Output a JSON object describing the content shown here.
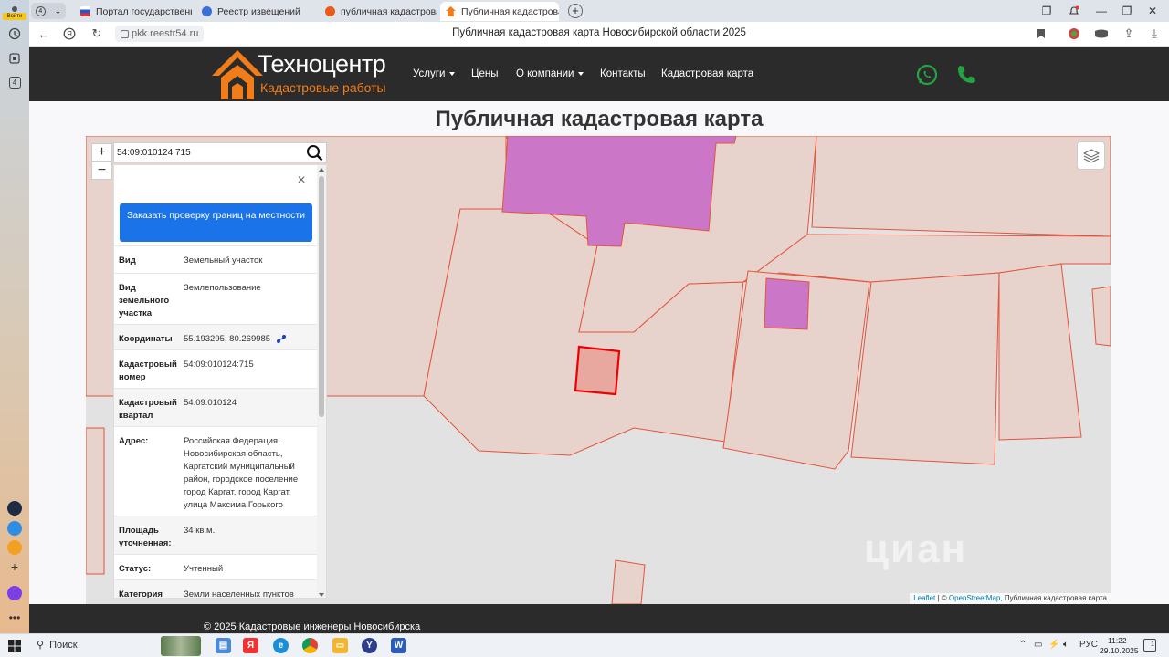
{
  "browser": {
    "profile_label": "Войти",
    "tab_counter": "4",
    "tabs": [
      {
        "title": "Портал государственных ",
        "favicon_color": "#d33"
      },
      {
        "title": "Реестр извещений",
        "favicon_color": "#3a6fd8"
      },
      {
        "title": "публичная кадастровая к",
        "favicon_color": "#e85b1a"
      },
      {
        "title": "Публичная кадастровая ",
        "favicon_color": "#f07d1a"
      }
    ],
    "new_tab": "+",
    "url": "pkk.reestr54.ru",
    "page_title": "Публичная кадастровая карта Новосибирской области 2025",
    "sidebar_badge": "4"
  },
  "site": {
    "logo_name": "Техноцентр",
    "logo_subtitle": "Кадастровые работы",
    "nav": [
      {
        "label": "Услуги",
        "dropdown": true
      },
      {
        "label": "Цены",
        "dropdown": false
      },
      {
        "label": "О компании",
        "dropdown": true
      },
      {
        "label": "Контакты",
        "dropdown": false
      },
      {
        "label": "Кадастровая карта",
        "dropdown": false
      }
    ],
    "brand_color": "#f07d1a",
    "heading": "Публичная кадастровая карта",
    "footer_text": "© 2025 Кадастровые инженеры Новосибирска"
  },
  "map": {
    "zoom_in": "+",
    "zoom_out": "−",
    "search_value": "54:09:010124:715",
    "watermark": "циан",
    "attribution": {
      "leaflet": "Leaflet",
      "sep": " | © ",
      "osm": "OpenStreetMap",
      "layer": ", Публичная кадастровая карта"
    }
  },
  "popup": {
    "close": "×",
    "order_button": "Заказать проверку границ на местности",
    "rows": [
      {
        "key": "Вид",
        "value": "Земельный участок"
      },
      {
        "key": "Вид земельного участка",
        "value": "Землепользование"
      },
      {
        "key": "Координаты",
        "value": "55.193295, 80.269985"
      },
      {
        "key": "Кадастровый номер",
        "value": "54:09:010124:715"
      },
      {
        "key": "Кадастровый квартал",
        "value": "54:09:010124"
      },
      {
        "key": "Адрес:",
        "value": "Российская Федерация, Новосибирская область, Каргатский муниципальный район, городское поселение город Каргат, город Каргат, улица Максима Горького"
      },
      {
        "key": "Площадь уточненная:",
        "value": "34 кв.м."
      },
      {
        "key": "Статус:",
        "value": "Учтенный"
      },
      {
        "key": "Категория",
        "value": "Земли населенных пунктов"
      }
    ]
  },
  "taskbar": {
    "search": "Поиск",
    "lang": "РУС",
    "time": "11:22",
    "date": "29.10.2025",
    "notifications": "1"
  }
}
